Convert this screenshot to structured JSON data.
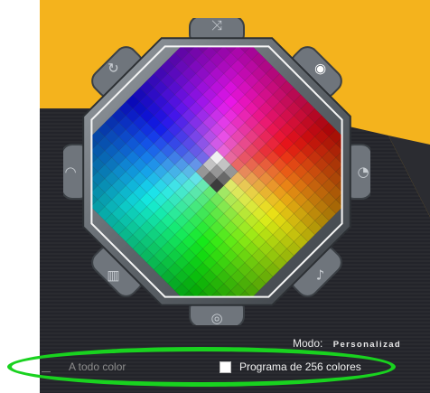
{
  "colors": {
    "background_yellow": "#f4b31d",
    "panel_dark": "#26272c",
    "highlight": "#19d21f",
    "frame_metal": "#6f757c"
  },
  "color_wheel": {
    "center_icon": "grayscale-diamond",
    "side_icons": [
      "shuffle-icon",
      "palette-icon",
      "brightness-icon",
      "music-icon",
      "speed-icon",
      "rgb-bars-icon",
      "wave-icon",
      "spin-icon"
    ]
  },
  "mode": {
    "label": "Modo:",
    "value": "Personalizad"
  },
  "color_options": {
    "full_color": "A todo color",
    "color_256": "Programa de 256 colores"
  }
}
